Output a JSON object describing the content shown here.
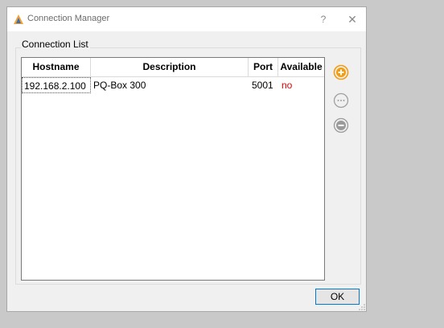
{
  "window": {
    "title": "Connection Manager",
    "help_label": "?",
    "close_label": "✕"
  },
  "group": {
    "label": "Connection List"
  },
  "table": {
    "columns": [
      "Hostname",
      "Description",
      "Port",
      "Available"
    ],
    "rows": [
      {
        "hostname": "192.168.2.100",
        "description": "PQ-Box 300",
        "port": "5001",
        "available": "no"
      }
    ]
  },
  "buttons": {
    "add_icon": "plus-circle-icon",
    "edit_icon": "more-circle-icon",
    "remove_icon": "minus-circle-icon",
    "ok_label": "OK"
  },
  "colors": {
    "accent_orange": "#f39c12",
    "disabled_gray": "#9a9a9a",
    "unavailable_red": "#e00000",
    "focus_blue": "#0078d7"
  }
}
